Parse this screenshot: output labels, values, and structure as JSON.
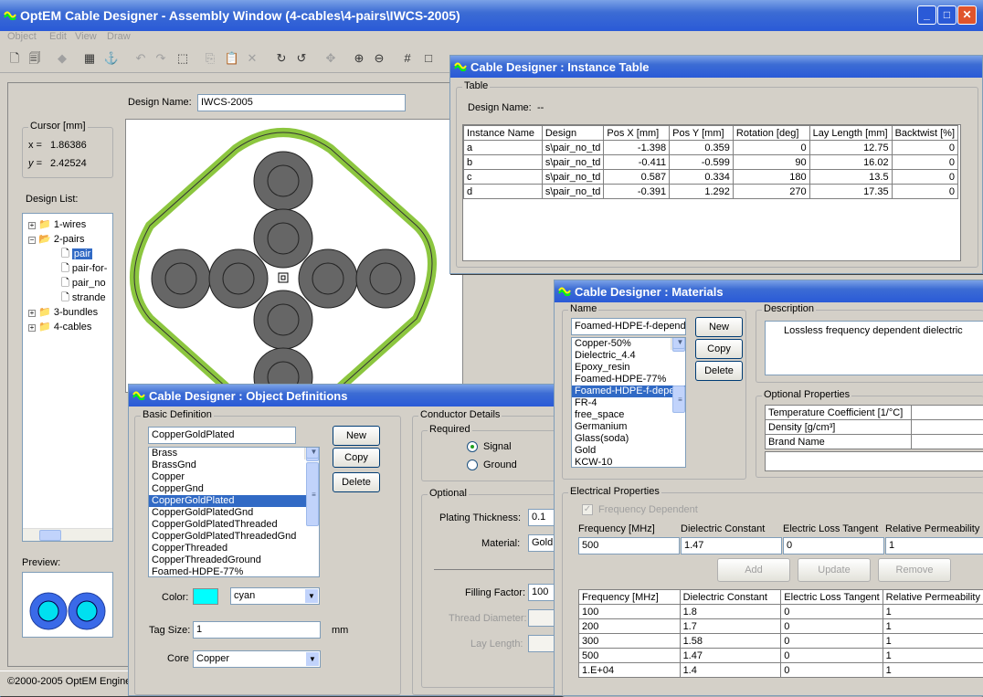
{
  "main": {
    "title": "OptEM Cable Designer - Assembly Window  (4-cables\\4-pairs\\IWCS-2005)",
    "menu": [
      "Object",
      "Edit",
      "View",
      "Draw"
    ],
    "design_name_label": "Design Name:",
    "design_name": "IWCS-2005",
    "cursor_label": "Cursor [mm]",
    "x_label": "x =",
    "x_val": "1.86386",
    "y_label": "y =",
    "y_val": "2.42524",
    "design_list_label": "Design List:",
    "tree": [
      {
        "label": "1-wires",
        "type": "folder"
      },
      {
        "label": "2-pairs",
        "type": "folder-open"
      },
      {
        "label": "pair",
        "type": "doc",
        "selected": true
      },
      {
        "label": "pair-for-",
        "type": "doc"
      },
      {
        "label": "pair_no",
        "type": "doc"
      },
      {
        "label": "strande",
        "type": "doc"
      },
      {
        "label": "3-bundles",
        "type": "folder"
      },
      {
        "label": "4-cables",
        "type": "folder"
      }
    ],
    "preview_label": "Preview:",
    "status": "©2000-2005 OptEM Engine"
  },
  "instance": {
    "title": "Cable Designer : Instance Table",
    "group": "Table",
    "design_name_label": "Design Name:",
    "design_name": "--",
    "columns": [
      "Instance Name",
      "Design",
      "Pos X [mm]",
      "Pos Y [mm]",
      "Rotation [deg]",
      "Lay Length [mm]",
      "Backtwist [%]"
    ],
    "rows": [
      [
        "a",
        "s\\pair_no_td",
        "-1.398",
        "0.359",
        "0",
        "12.75",
        "0"
      ],
      [
        "b",
        "s\\pair_no_td",
        "-0.411",
        "-0.599",
        "90",
        "16.02",
        "0"
      ],
      [
        "c",
        "s\\pair_no_td",
        "0.587",
        "0.334",
        "180",
        "13.5",
        "0"
      ],
      [
        "d",
        "s\\pair_no_td",
        "-0.391",
        "1.292",
        "270",
        "17.35",
        "0"
      ]
    ]
  },
  "objdef": {
    "title": "Cable Designer : Object Definitions",
    "basic_label": "Basic Definition",
    "name_value": "CopperGoldPlated",
    "items": [
      "Brass",
      "BrassGnd",
      "Copper",
      "CopperGnd",
      "CopperGoldPlated",
      "CopperGoldPlatedGnd",
      "CopperGoldPlatedThreaded",
      "CopperGoldPlatedThreadedGnd",
      "CopperThreaded",
      "CopperThreadedGround",
      "Foamed-HDPE-77%"
    ],
    "selected": "CopperGoldPlated",
    "new": "New",
    "copy": "Copy",
    "delete": "Delete",
    "color_label": "Color:",
    "color_value": "cyan",
    "color_hex": "#00ffff",
    "tag_label": "Tag Size:",
    "tag_value": "1",
    "tag_unit": "mm",
    "core_label": "Core",
    "core_value": "Copper",
    "conductor_label": "Conductor Details",
    "required_label": "Required",
    "signal": "Signal",
    "ground": "Ground",
    "optional_label": "Optional",
    "plating_label": "Plating Thickness:",
    "plating_value": "0.1",
    "material_label": "Material:",
    "material_value": "Gold",
    "filling_label": "Filling Factor:",
    "filling_value": "100",
    "thread_label": "Thread Diameter:",
    "lay_label": "Lay Length:"
  },
  "materials": {
    "title": "Cable Designer : Materials",
    "name_label": "Name",
    "name_value": "Foamed-HDPE-f-depende",
    "items": [
      "Copper-50%",
      "Dielectric_4.4",
      "Epoxy_resin",
      "Foamed-HDPE-77%",
      "Foamed-HDPE-f-depen",
      "FR-4",
      "free_space",
      "Germanium",
      "Glass(soda)",
      "Gold",
      "KCW-10"
    ],
    "selected": "Foamed-HDPE-f-depen",
    "new": "New",
    "copy": "Copy",
    "delete": "Delete",
    "desc_label": "Description",
    "desc": "Lossless frequency dependent dielectric",
    "optprops_label": "Optional Properties",
    "props": [
      "Temperature Coefficient [1/°C]",
      "Density [g/cm³]",
      "Brand Name"
    ],
    "elec_label": "Electrical Properties",
    "freqdep": "Frequency Dependent",
    "in_headers": [
      "Frequency [MHz]",
      "Dielectric Constant",
      "Electric Loss Tangent",
      "Relative Permeability"
    ],
    "in_values": [
      "500",
      "1.47",
      "0",
      "1"
    ],
    "add": "Add",
    "update": "Update",
    "remove": "Remove",
    "columns": [
      "Frequency [MHz]",
      "Dielectric Constant",
      "Electric Loss Tangent",
      "Relative Permeability"
    ],
    "rows": [
      [
        "100",
        "1.8",
        "0",
        "1"
      ],
      [
        "200",
        "1.7",
        "0",
        "1"
      ],
      [
        "300",
        "1.58",
        "0",
        "1"
      ],
      [
        "500",
        "1.47",
        "0",
        "1"
      ],
      [
        "1.E+04",
        "1.4",
        "0",
        "1"
      ]
    ]
  }
}
